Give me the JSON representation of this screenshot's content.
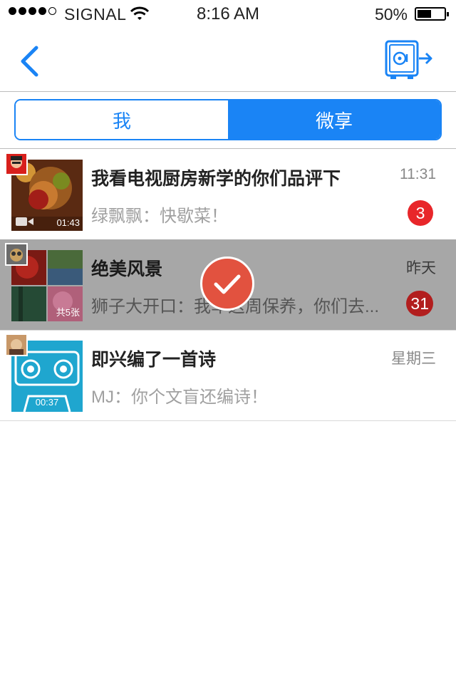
{
  "status_bar": {
    "carrier": "SIGNAL",
    "time": "8:16 AM",
    "battery_pct": "50%"
  },
  "nav": {
    "back_icon": "chevron-left-icon",
    "action_icon": "safe-exit-icon",
    "accent": "#1a84f5"
  },
  "segment": {
    "options": [
      "我",
      "微享"
    ],
    "selected": "微享"
  },
  "chats": [
    {
      "title": "我看电视厨房新学的你们品评下",
      "time": "11:31",
      "preview": "绿飘飘：快歇菜！",
      "badge": "3",
      "thumb_caption": "01:43"
    },
    {
      "title": "绝美风景",
      "time": "昨天",
      "preview": "狮子大开口：我车这周保养，你们去...",
      "badge": "31",
      "thumb_caption": "共5张",
      "selected": true
    },
    {
      "title": "即兴编了一首诗",
      "time": "星期三",
      "preview": "MJ：你个文盲还编诗！",
      "thumb_caption": "00:37"
    }
  ],
  "colors": {
    "badge": "#e8262a",
    "selected_row": "#a7a7a7",
    "check": "#e2523f"
  }
}
